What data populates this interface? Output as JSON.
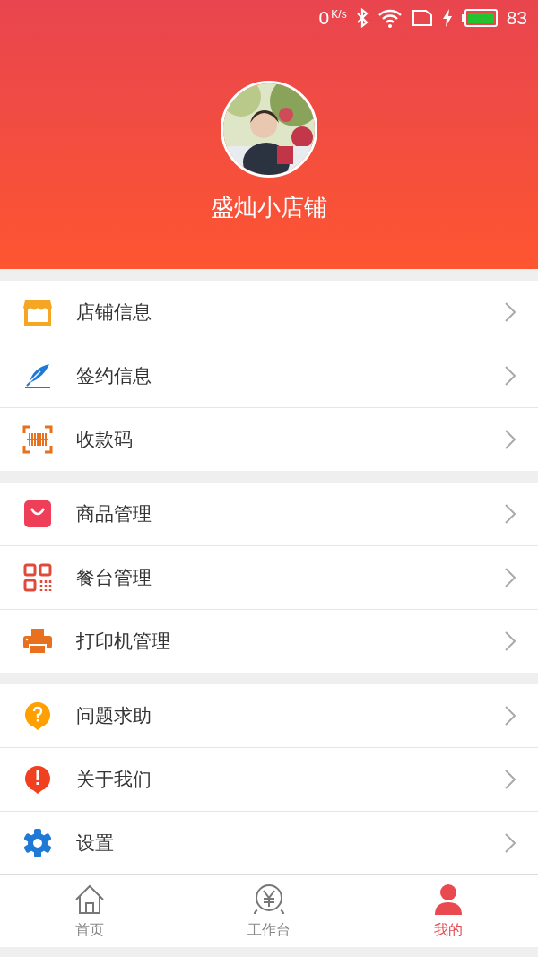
{
  "status_bar": {
    "speed": "0",
    "speed_unit": "K/s",
    "battery": "83"
  },
  "profile": {
    "name": "盛灿小店铺"
  },
  "sections": [
    {
      "items": [
        {
          "label": "店铺信息"
        },
        {
          "label": "签约信息"
        },
        {
          "label": "收款码"
        }
      ]
    },
    {
      "items": [
        {
          "label": "商品管理"
        },
        {
          "label": "餐台管理"
        },
        {
          "label": "打印机管理"
        }
      ]
    },
    {
      "items": [
        {
          "label": "问题求助"
        },
        {
          "label": "关于我们"
        },
        {
          "label": "设置"
        }
      ]
    }
  ],
  "tabs": [
    {
      "label": "首页",
      "selected": false
    },
    {
      "label": "工作台",
      "selected": false
    },
    {
      "label": "我的",
      "selected": true
    }
  ]
}
